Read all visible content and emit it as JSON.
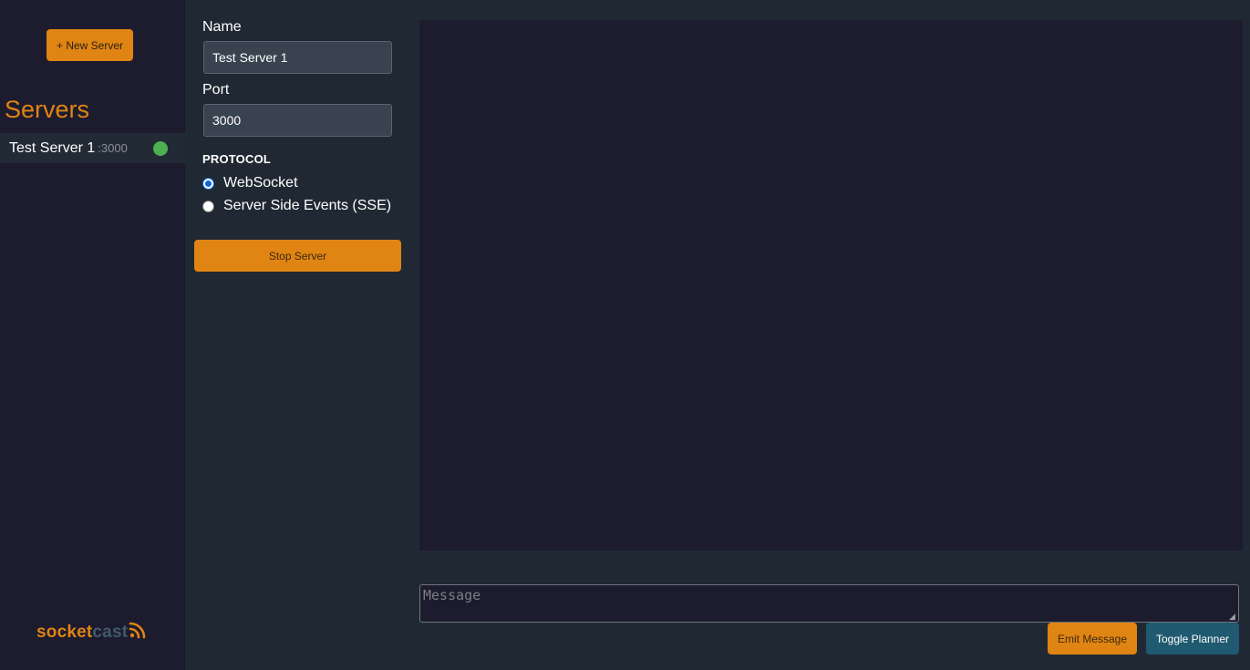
{
  "sidebar": {
    "new_server_label": "+ New Server",
    "servers_heading": "Servers",
    "servers": [
      {
        "name": "Test Server 1",
        "port": ":3000",
        "status": "running",
        "status_color": "#4caf50"
      }
    ],
    "logo": {
      "part1": "socket",
      "part2": "cast",
      "icon": "rss-icon"
    }
  },
  "config": {
    "name_label": "Name",
    "name_value": "Test Server 1",
    "port_label": "Port",
    "port_value": "3000",
    "protocol_label": "PROTOCOL",
    "protocols": [
      {
        "label": "WebSocket",
        "checked": true
      },
      {
        "label": "Server Side Events (SSE)",
        "checked": false
      }
    ],
    "stop_label": "Stop Server"
  },
  "main": {
    "message_placeholder": "Message",
    "emit_label": "Emit Message",
    "toggle_label": "Toggle Planner"
  },
  "colors": {
    "accent": "#e08414",
    "sidebar_bg": "#1d1b2e",
    "page_bg": "#202933",
    "teal_button": "#1f5a70"
  }
}
